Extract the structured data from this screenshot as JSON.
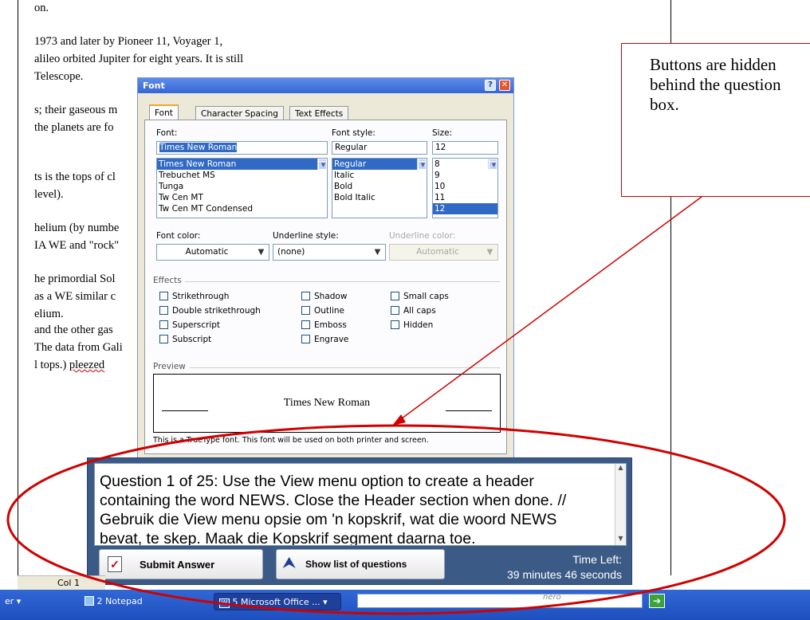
{
  "document": {
    "lines": [
      "on.",
      "1973 and later by Pioneer 11, Voyager 1,",
      "alileo orbited Jupiter for eight years. It is still",
      "Telescope.",
      "s; their gaseous m",
      "the planets are fo",
      "ts is the tops of cl",
      "level).",
      "helium (by numbe",
      "IA WE and \"rock\"",
      "he primordial Sol",
      "as a WE similar c",
      "elium.",
      "and the other gas",
      "The data from Gali",
      "l tops.)"
    ],
    "misspelled_word": "pleezed"
  },
  "callout": {
    "text": "Buttons are hidden behind the question box."
  },
  "font_dialog": {
    "title": "Font",
    "tabs": [
      "Font",
      "Character Spacing",
      "Text Effects"
    ],
    "font_label": "Font:",
    "font_value": "Times New Roman",
    "font_list": [
      "Times New Roman",
      "Trebuchet MS",
      "Tunga",
      "Tw Cen MT",
      "Tw Cen MT Condensed"
    ],
    "style_label": "Font style:",
    "style_value": "Regular",
    "style_list": [
      "Regular",
      "Italic",
      "Bold",
      "Bold Italic"
    ],
    "size_label": "Size:",
    "size_value": "12",
    "size_list": [
      "8",
      "9",
      "10",
      "11",
      "12"
    ],
    "font_color_label": "Font color:",
    "font_color_value": "Automatic",
    "underline_style_label": "Underline style:",
    "underline_style_value": "(none)",
    "underline_color_label": "Underline color:",
    "underline_color_value": "Automatic",
    "effects_label": "Effects",
    "effects_col1": [
      "Strikethrough",
      "Double strikethrough",
      "Superscript",
      "Subscript"
    ],
    "effects_col2": [
      "Shadow",
      "Outline",
      "Emboss",
      "Engrave"
    ],
    "effects_col3": [
      "Small caps",
      "All caps",
      "Hidden"
    ],
    "preview_label": "Preview",
    "preview_text": "Times New Roman",
    "truetype_note": "This is a TrueType font. This font will be used on both printer and screen."
  },
  "question_box": {
    "question": "Question 1 of 25: Use the View menu option to create a header containing the word NEWS. Close the Header section when done. // Gebruik die View menu opsie om 'n kopskrif, wat die woord NEWS bevat, te skep. Maak die Kopskrif segment daarna toe.",
    "submit_label": "Submit Answer",
    "list_label": "Show list of questions",
    "time_label": "Time Left:",
    "time_value": "39 minutes 46 seconds"
  },
  "status": {
    "col": "Col 1"
  },
  "taskbar": {
    "items": [
      "er",
      "2 Notepad",
      "5 Microsoft Office ..."
    ],
    "nero_label": "nero"
  },
  "colors": {
    "annotation_red": "#d00000",
    "xp_blue": "#3168d5",
    "question_bg": "#3b5a85"
  }
}
